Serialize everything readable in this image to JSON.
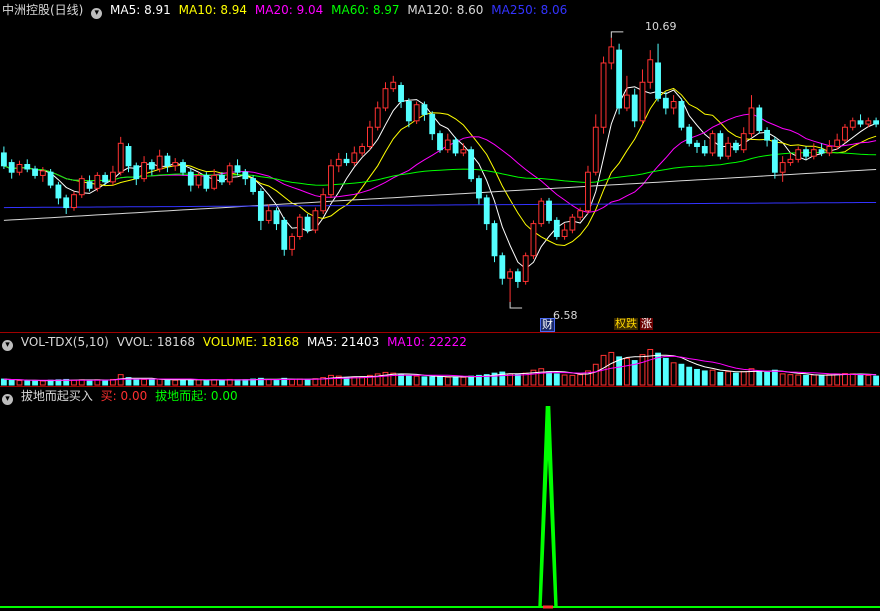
{
  "price_legend": {
    "title": "中洲控股(日线)",
    "items": [
      {
        "label": "MA5: 8.91",
        "color": "#ffffff"
      },
      {
        "label": "MA10: 8.94",
        "color": "#ffff00"
      },
      {
        "label": "MA20: 9.04",
        "color": "#ff00ff"
      },
      {
        "label": "MA60: 8.97",
        "color": "#00ff00"
      },
      {
        "label": "MA120: 8.60",
        "color": "#d8d8d8"
      },
      {
        "label": "MA250: 8.06",
        "color": "#3333ff"
      }
    ]
  },
  "vol_legend": {
    "title": "VOL-TDX(5,10)",
    "items": [
      {
        "label": "VVOL: 18168",
        "color": "#d8d8d8"
      },
      {
        "label": "VOLUME: 18168",
        "color": "#ffff00"
      },
      {
        "label": "MA5: 21403",
        "color": "#ffffff"
      },
      {
        "label": "MA10: 22222",
        "color": "#ff00ff"
      }
    ]
  },
  "sig_legend": {
    "title": "拔地而起买入",
    "items": [
      {
        "label": "买: 0.00",
        "color": "#ff3030"
      },
      {
        "label": "拔地而起: 0.00",
        "color": "#00ff00"
      }
    ]
  },
  "annotations": {
    "high": "10.69",
    "low": "6.58",
    "tag_cai": "财",
    "tag_die": "权跌",
    "tag_zhang": "涨"
  },
  "chart_data": [
    {
      "type": "candlestick",
      "title": "中洲控股(日线)",
      "ylim": [
        6.3,
        11.0
      ],
      "max_label": 10.69,
      "min_label": 6.58,
      "up_color": "#ff3232",
      "down_color": "#54ffff",
      "candles": [
        [
          8.9,
          8.7,
          9.0,
          8.65
        ],
        [
          8.75,
          8.6,
          8.8,
          8.5
        ],
        [
          8.6,
          8.72,
          8.78,
          8.55
        ],
        [
          8.72,
          8.65,
          8.8,
          8.6
        ],
        [
          8.65,
          8.55,
          8.7,
          8.5
        ],
        [
          8.55,
          8.62,
          8.68,
          8.45
        ],
        [
          8.6,
          8.4,
          8.65,
          8.35
        ],
        [
          8.4,
          8.2,
          8.45,
          8.1
        ],
        [
          8.2,
          8.05,
          8.25,
          7.95
        ],
        [
          8.05,
          8.25,
          8.3,
          8.0
        ],
        [
          8.25,
          8.5,
          8.55,
          8.2
        ],
        [
          8.45,
          8.35,
          8.55,
          8.3
        ],
        [
          8.35,
          8.55,
          8.6,
          8.3
        ],
        [
          8.55,
          8.45,
          8.6,
          8.4
        ],
        [
          8.45,
          8.6,
          8.7,
          8.4
        ],
        [
          8.6,
          9.05,
          9.15,
          8.55
        ],
        [
          9.0,
          8.7,
          9.05,
          8.6
        ],
        [
          8.7,
          8.5,
          8.75,
          8.4
        ],
        [
          8.5,
          8.75,
          8.85,
          8.45
        ],
        [
          8.75,
          8.65,
          8.8,
          8.55
        ],
        [
          8.65,
          8.85,
          8.95,
          8.6
        ],
        [
          8.85,
          8.7,
          8.9,
          8.6
        ],
        [
          8.7,
          8.75,
          8.82,
          8.62
        ],
        [
          8.75,
          8.6,
          8.8,
          8.55
        ],
        [
          8.6,
          8.4,
          8.65,
          8.3
        ],
        [
          8.4,
          8.55,
          8.6,
          8.35
        ],
        [
          8.55,
          8.35,
          8.6,
          8.3
        ],
        [
          8.35,
          8.55,
          8.65,
          8.32
        ],
        [
          8.55,
          8.45,
          8.6,
          8.4
        ],
        [
          8.45,
          8.7,
          8.75,
          8.4
        ],
        [
          8.7,
          8.6,
          8.8,
          8.55
        ],
        [
          8.6,
          8.5,
          8.65,
          8.4
        ],
        [
          8.5,
          8.3,
          8.55,
          8.25
        ],
        [
          8.3,
          7.85,
          8.35,
          7.7
        ],
        [
          7.85,
          8.0,
          8.1,
          7.8
        ],
        [
          8.0,
          7.8,
          8.05,
          7.7
        ],
        [
          7.85,
          7.4,
          7.9,
          7.3
        ],
        [
          7.4,
          7.6,
          7.65,
          7.3
        ],
        [
          7.6,
          7.9,
          7.95,
          7.55
        ],
        [
          7.9,
          7.7,
          7.95,
          7.65
        ],
        [
          7.7,
          8.0,
          8.05,
          7.65
        ],
        [
          8.0,
          8.25,
          8.35,
          7.95
        ],
        [
          8.25,
          8.7,
          8.8,
          8.2
        ],
        [
          8.7,
          8.8,
          8.9,
          8.6
        ],
        [
          8.8,
          8.75,
          8.9,
          8.7
        ],
        [
          8.75,
          8.9,
          9.0,
          8.7
        ],
        [
          8.9,
          9.0,
          9.05,
          8.85
        ],
        [
          9.0,
          9.3,
          9.4,
          8.95
        ],
        [
          9.3,
          9.6,
          9.7,
          9.25
        ],
        [
          9.6,
          9.9,
          10.0,
          9.55
        ],
        [
          9.9,
          10.0,
          10.1,
          9.85
        ],
        [
          9.95,
          9.7,
          10.0,
          9.6
        ],
        [
          9.7,
          9.4,
          9.75,
          9.3
        ],
        [
          9.4,
          9.65,
          9.7,
          9.35
        ],
        [
          9.65,
          9.5,
          9.7,
          9.4
        ],
        [
          9.5,
          9.2,
          9.55,
          9.1
        ],
        [
          9.2,
          8.95,
          9.25,
          8.9
        ],
        [
          8.95,
          9.1,
          9.2,
          8.9
        ],
        [
          9.1,
          8.9,
          9.15,
          8.85
        ],
        [
          8.9,
          8.95,
          9.05,
          8.85
        ],
        [
          8.95,
          8.5,
          9.0,
          8.45
        ],
        [
          8.5,
          8.2,
          8.55,
          8.1
        ],
        [
          8.2,
          7.8,
          8.25,
          7.7
        ],
        [
          7.8,
          7.3,
          7.85,
          7.2
        ],
        [
          7.3,
          6.95,
          7.35,
          6.85
        ],
        [
          6.95,
          7.05,
          7.1,
          6.58
        ],
        [
          7.05,
          6.9,
          7.1,
          6.8
        ],
        [
          6.9,
          7.3,
          7.35,
          6.85
        ],
        [
          7.3,
          7.8,
          7.85,
          7.25
        ],
        [
          7.8,
          8.15,
          8.2,
          7.75
        ],
        [
          8.15,
          7.85,
          8.2,
          7.8
        ],
        [
          7.85,
          7.6,
          7.9,
          7.55
        ],
        [
          7.6,
          7.7,
          7.8,
          7.55
        ],
        [
          7.7,
          7.9,
          7.95,
          7.65
        ],
        [
          7.9,
          8.0,
          8.05,
          7.85
        ],
        [
          8.0,
          8.6,
          8.7,
          7.95
        ],
        [
          8.6,
          9.3,
          9.5,
          8.55
        ],
        [
          9.3,
          10.3,
          10.4,
          9.2
        ],
        [
          10.3,
          10.55,
          10.69,
          10.2
        ],
        [
          10.5,
          9.6,
          10.6,
          9.5
        ],
        [
          9.6,
          9.8,
          10.1,
          9.55
        ],
        [
          9.8,
          9.4,
          9.9,
          9.3
        ],
        [
          9.4,
          10.0,
          10.2,
          9.35
        ],
        [
          10.0,
          10.35,
          10.5,
          9.9
        ],
        [
          10.3,
          9.75,
          10.6,
          9.7
        ],
        [
          9.75,
          9.6,
          9.85,
          9.5
        ],
        [
          9.6,
          9.7,
          9.8,
          9.5
        ],
        [
          9.7,
          9.3,
          9.75,
          9.25
        ],
        [
          9.3,
          9.05,
          9.35,
          9.0
        ],
        [
          9.05,
          9.0,
          9.1,
          8.9
        ],
        [
          9.0,
          8.9,
          9.1,
          8.85
        ],
        [
          8.9,
          9.2,
          9.25,
          8.85
        ],
        [
          9.2,
          8.85,
          9.25,
          8.8
        ],
        [
          8.85,
          9.05,
          9.15,
          8.8
        ],
        [
          9.05,
          8.95,
          9.1,
          8.9
        ],
        [
          8.95,
          9.2,
          9.3,
          8.9
        ],
        [
          9.2,
          9.6,
          9.8,
          9.15
        ],
        [
          9.6,
          9.25,
          9.65,
          9.2
        ],
        [
          9.25,
          9.1,
          9.3,
          9.0
        ],
        [
          9.1,
          8.6,
          9.15,
          8.5
        ],
        [
          8.6,
          8.75,
          8.85,
          8.45
        ],
        [
          8.75,
          8.8,
          8.9,
          8.7
        ],
        [
          8.8,
          8.95,
          9.0,
          8.75
        ],
        [
          8.95,
          8.85,
          9.0,
          8.8
        ],
        [
          8.85,
          8.95,
          9.05,
          8.8
        ],
        [
          8.95,
          8.9,
          9.05,
          8.85
        ],
        [
          8.9,
          9.0,
          9.1,
          8.85
        ],
        [
          9.0,
          9.1,
          9.2,
          8.95
        ],
        [
          9.1,
          9.3,
          9.35,
          9.05
        ],
        [
          9.3,
          9.4,
          9.45,
          9.25
        ],
        [
          9.4,
          9.35,
          9.5,
          9.3
        ],
        [
          9.35,
          9.4,
          9.45,
          9.3
        ],
        [
          9.4,
          9.35,
          9.45,
          9.3
        ]
      ]
    },
    {
      "type": "bar",
      "title": "VOL-TDX(5,10)",
      "values": [
        16,
        14,
        12,
        11,
        12,
        11,
        13,
        14,
        15,
        13,
        14,
        13,
        14,
        13,
        15,
        28,
        20,
        14,
        15,
        14,
        16,
        14,
        13,
        14,
        15,
        14,
        13,
        14,
        13,
        15,
        14,
        14,
        16,
        18,
        15,
        14,
        18,
        15,
        16,
        14,
        17,
        20,
        26,
        24,
        20,
        22,
        22,
        26,
        30,
        34,
        32,
        28,
        25,
        24,
        22,
        22,
        23,
        21,
        22,
        21,
        24,
        26,
        28,
        32,
        35,
        30,
        28,
        32,
        40,
        44,
        36,
        30,
        27,
        26,
        28,
        38,
        56,
        80,
        88,
        76,
        72,
        66,
        82,
        96,
        86,
        72,
        60,
        56,
        48,
        42,
        38,
        40,
        34,
        36,
        32,
        36,
        44,
        38,
        34,
        40,
        30,
        28,
        27,
        26,
        27,
        26,
        28,
        30,
        31,
        30,
        29,
        26,
        24
      ],
      "ylim": [
        0,
        100
      ]
    },
    {
      "type": "line",
      "title": "拔地而起买入",
      "series": [
        {
          "name": "买",
          "values": [
            0,
            0,
            1.0,
            0,
            0
          ]
        },
        {
          "name": "拔地而起",
          "values": [
            0,
            0,
            1.0,
            0,
            0
          ]
        }
      ],
      "ylim": [
        0,
        1.0
      ]
    }
  ]
}
